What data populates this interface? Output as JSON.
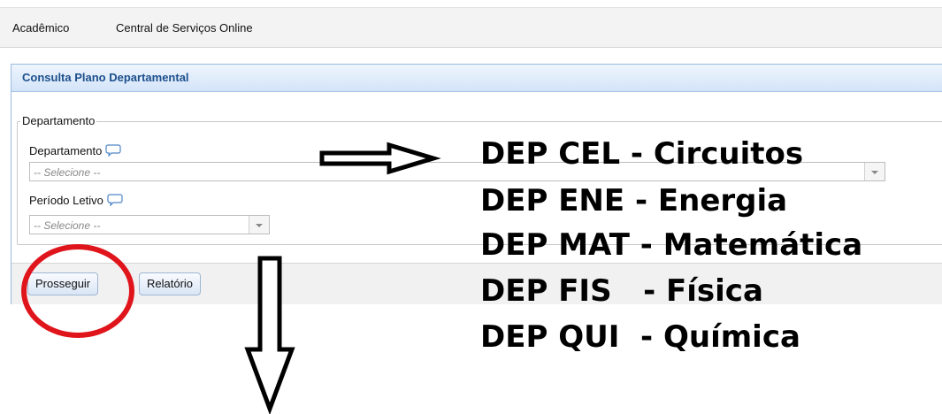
{
  "menu": {
    "items": [
      "Acadêmico",
      "Central de Serviços Online"
    ]
  },
  "panel": {
    "title": "Consulta Plano Departamental",
    "fieldset_legend": "Departamento",
    "departamento": {
      "label": "Departamento",
      "value": "-- Selecione --"
    },
    "periodo": {
      "label": "Período Letivo",
      "value": "-- Selecione --"
    },
    "buttons": {
      "prosseguir": "Prosseguir",
      "relatorio": "Relatório"
    }
  },
  "annotations": {
    "lines": [
      "DEP CEL - Circuitos",
      "DEP ENE - Energia",
      "DEP MAT - Matemática",
      "DEP FIS   - Física",
      "DEP QUI  - Química"
    ],
    "colors": {
      "circle": "#e0141b",
      "arrow": "#000000"
    }
  }
}
